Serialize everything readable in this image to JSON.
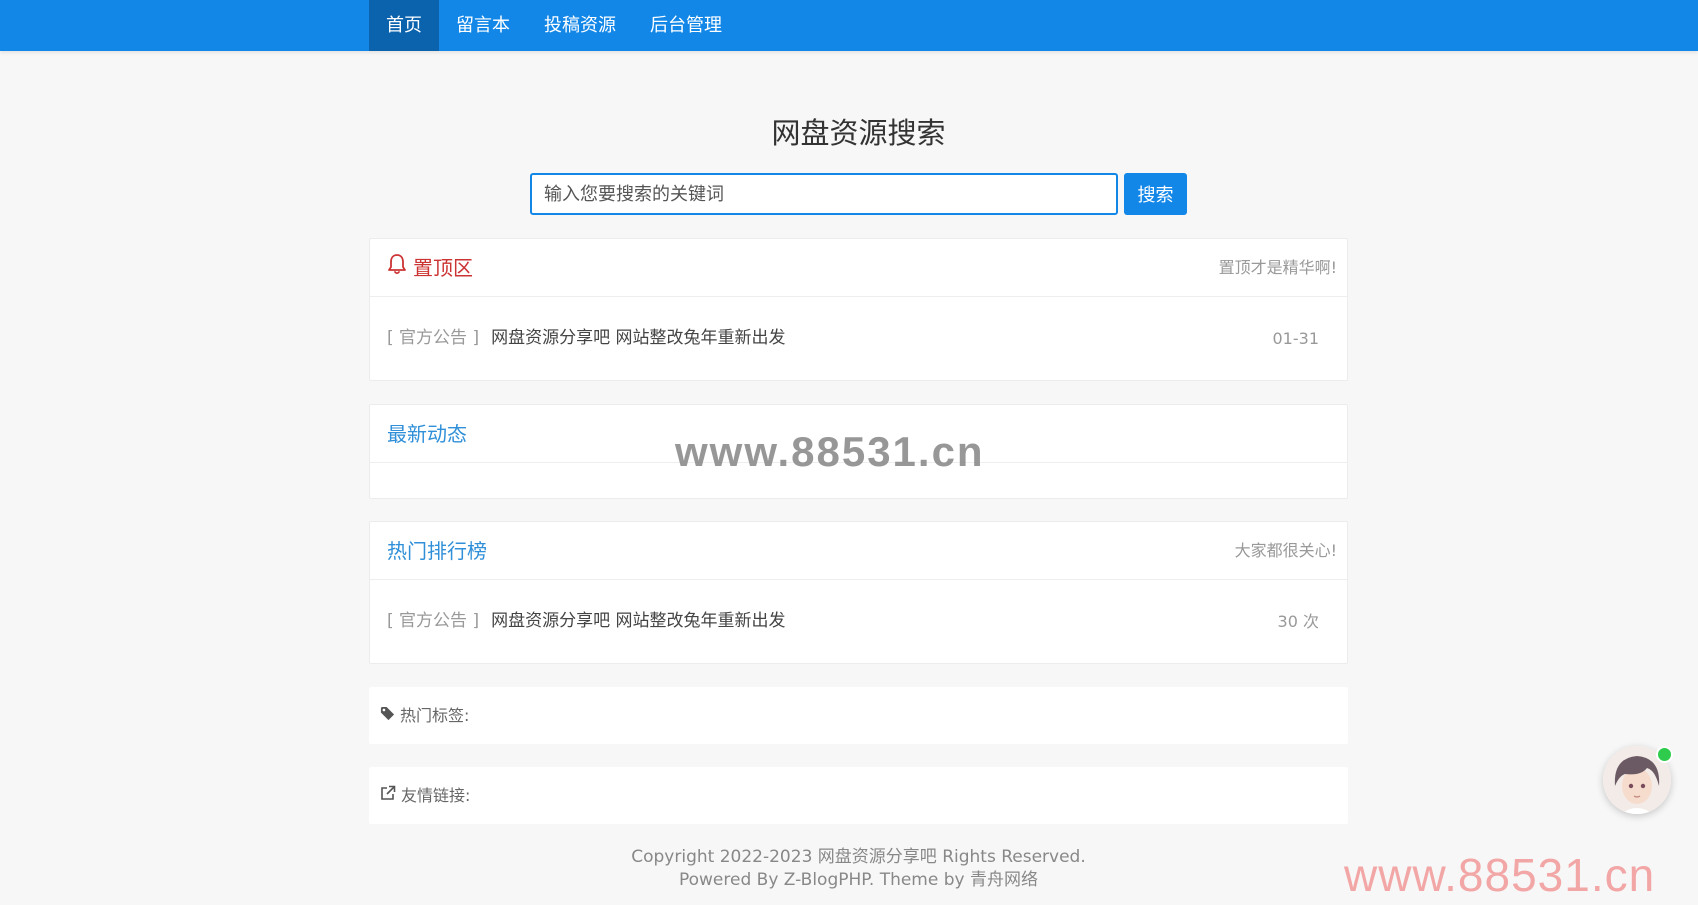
{
  "nav": {
    "items": [
      {
        "label": "首页",
        "active": true
      },
      {
        "label": "留言本",
        "active": false
      },
      {
        "label": "投稿资源",
        "active": false
      },
      {
        "label": "后台管理",
        "active": false
      }
    ]
  },
  "site_title": "网盘资源搜索",
  "search": {
    "placeholder": "输入您要搜索的关键词",
    "button_label": "搜索"
  },
  "pinned": {
    "title": "置顶区",
    "subtitle": "置顶才是精华啊!",
    "items": [
      {
        "category": "[ 官方公告 ]",
        "title": "网盘资源分享吧 网站整改兔年重新出发",
        "date": "01-31"
      }
    ]
  },
  "latest": {
    "title": "最新动态"
  },
  "hot": {
    "title": "热门排行榜",
    "subtitle": "大家都很关心!",
    "items": [
      {
        "category": "[ 官方公告 ]",
        "title": "网盘资源分享吧 网站整改兔年重新出发",
        "views": "30 次"
      }
    ]
  },
  "hot_tags": {
    "label": "热门标签:"
  },
  "friend_links": {
    "label": "友情链接:"
  },
  "footer": {
    "line1": "Copyright 2022-2023 网盘资源分享吧 Rights Reserved.",
    "line2": "Powered By Z-BlogPHP. Theme by 青舟网络"
  },
  "watermarks": {
    "center": "www.88531.cn",
    "corner": "www.88531.cn"
  },
  "icons": {
    "pinned": "bell-icon",
    "hot_tags": "tag-icon",
    "friend_links": "external-link-icon"
  },
  "colors": {
    "nav_bg": "#1287e8",
    "nav_active": "#0b63ad",
    "accent": "#1287e8",
    "pinned_title": "#cc3333",
    "section_title": "#2f8fd8"
  }
}
